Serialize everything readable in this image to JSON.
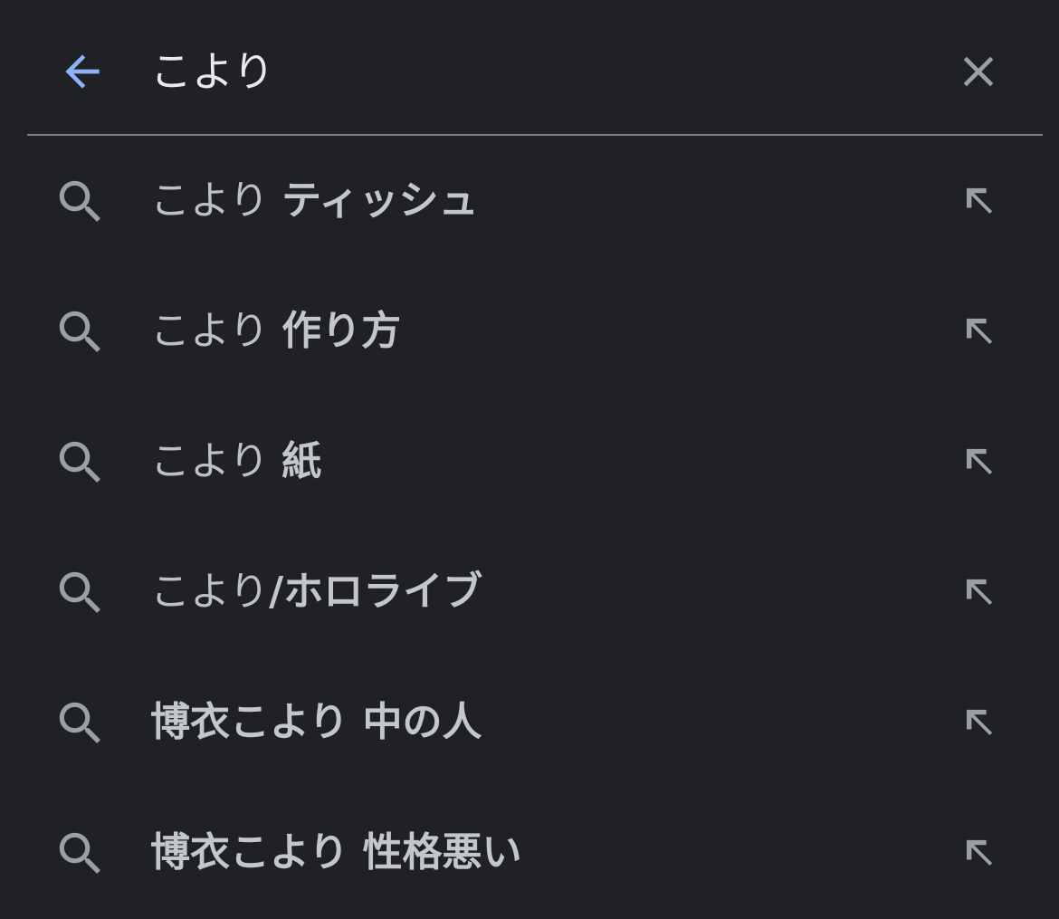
{
  "search": {
    "query": "こより",
    "back_icon": "arrow-back-icon",
    "clear_icon": "close-icon",
    "accent_color": "#8ab4f8"
  },
  "suggestions": [
    {
      "prefix": "こより ",
      "rest": "ティッシュ"
    },
    {
      "prefix": "こより ",
      "rest": "作り方"
    },
    {
      "prefix": "こより ",
      "rest": "紙"
    },
    {
      "prefix": "こより",
      "rest": "/ホロライブ"
    },
    {
      "prefix": "",
      "rest": "博衣こより 中の人"
    },
    {
      "prefix": "",
      "rest": "博衣こより 性格悪い"
    }
  ],
  "suggestion_icon": "search-icon",
  "fill_icon": "arrow-up-left-icon"
}
